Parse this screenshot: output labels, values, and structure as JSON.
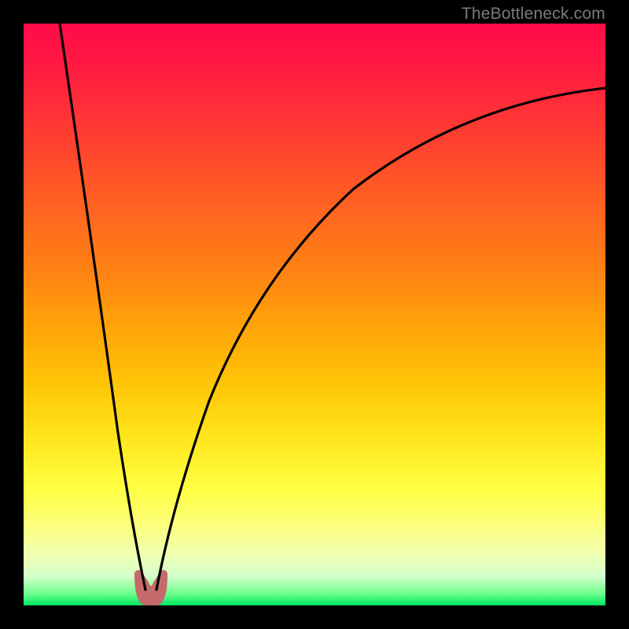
{
  "watermark": {
    "text": "TheBottleneck.com"
  },
  "colors": {
    "frame": "#000000",
    "curve": "#000000",
    "dip_highlight": "#c46a6a",
    "gradient_stops": [
      "#ff0b49",
      "#ff1c41",
      "#ff3a33",
      "#ff5e23",
      "#ff8114",
      "#ffa309",
      "#ffc507",
      "#ffe820",
      "#ffff42",
      "#fcff7a",
      "#f1ffaf",
      "#d5ffcc",
      "#6dff8c",
      "#00e661"
    ]
  },
  "chart_data": {
    "type": "line",
    "title": "",
    "xlabel": "",
    "ylabel": "",
    "xlim": [
      0,
      100
    ],
    "ylim": [
      0,
      100
    ],
    "note": "Approximate V-curve: steep descent, minimum near x≈21, gradual re-ascent. Values read off as percentages of plot height from bottom.",
    "series": [
      {
        "name": "bottleneck-curve",
        "x": [
          6,
          8,
          10,
          12,
          14,
          16,
          18,
          19.5,
          21,
          22.5,
          24,
          27,
          31,
          36,
          42,
          49,
          57,
          66,
          76,
          87,
          100
        ],
        "values": [
          100,
          88,
          76,
          63,
          50,
          36,
          21,
          9,
          2,
          2,
          9,
          22,
          36,
          48,
          58,
          67,
          74,
          80,
          84,
          87,
          89
        ]
      }
    ],
    "dip_highlight": {
      "x_range": [
        19.5,
        22.5
      ],
      "y_range": [
        0,
        6
      ],
      "color": "#c46a6a"
    }
  }
}
